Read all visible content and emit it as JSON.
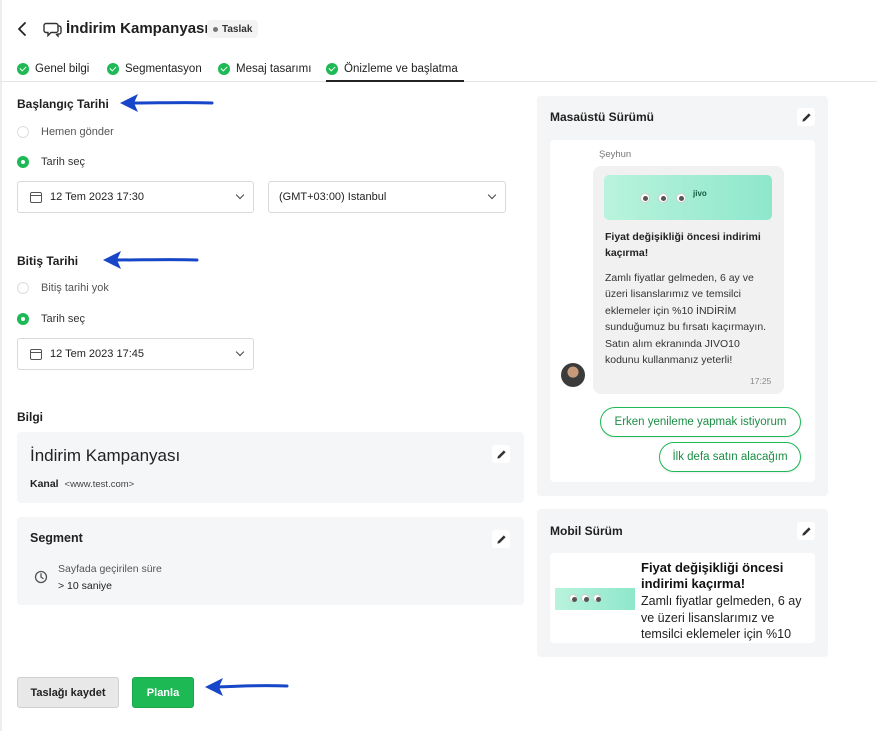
{
  "header": {
    "title": "İndirim Kampanyası",
    "status_badge": "Taslak"
  },
  "tabs": [
    {
      "label": "Genel bilgi",
      "completed": true,
      "active": false
    },
    {
      "label": "Segmentasyon",
      "completed": true,
      "active": false
    },
    {
      "label": "Mesaj tasarımı",
      "completed": true,
      "active": false
    },
    {
      "label": "Önizleme ve başlatma",
      "completed": true,
      "active": true
    }
  ],
  "start": {
    "title": "Başlangıç Tarihi",
    "option_now": "Hemen gönder",
    "option_date": "Tarih seç",
    "selected": "option_date",
    "date_value": "12 Tem 2023 17:30",
    "timezone_value": "(GMT+03:00) Istanbul"
  },
  "end": {
    "title": "Bitiş Tarihi",
    "option_none": "Bitiş tarihi yok",
    "option_date": "Tarih seç",
    "selected": "option_date",
    "date_value": "12 Tem 2023 17:45"
  },
  "info": {
    "title": "Bilgi",
    "campaign_name": "İndirim Kampanyası",
    "channel_label": "Kanal",
    "channel_value": "<www.test.com>"
  },
  "segment": {
    "title": "Segment",
    "rule_label": "Sayfada geçirilen süre",
    "rule_value": "> 10 saniye"
  },
  "actions": {
    "save_draft": "Taslağı kaydet",
    "schedule": "Planla"
  },
  "desktop": {
    "title": "Masaüstü Sürümü",
    "sender": "Şeyhun",
    "banner_brand": "jivo",
    "message_title": "Fiyat değişikliği öncesi indirimi kaçırma!",
    "message_body": "Zamlı fiyatlar gelmeden, 6 ay ve üzeri lisanslarımız ve temsilci eklemeler için %10 İNDİRİM sunduğumuz bu fırsatı kaçırmayın. Satın alım ekranında JIVO10 kodunu kullanmanız yeterli!",
    "time": "17:25",
    "reply_1": "Erken yenileme yapmak istiyorum",
    "reply_2": "İlk defa satın alacağım"
  },
  "mobile": {
    "title": "Mobil Sürüm",
    "message_title": "Fiyat değişikliği öncesi indirimi kaçırma!",
    "message_body": "Zamlı fiyatlar gelmeden, 6 ay ve üzeri lisanslarımız ve temsilci eklemeler için %10"
  },
  "colors": {
    "accent_green": "#1db954",
    "annotation_arrow": "#1746c9"
  }
}
